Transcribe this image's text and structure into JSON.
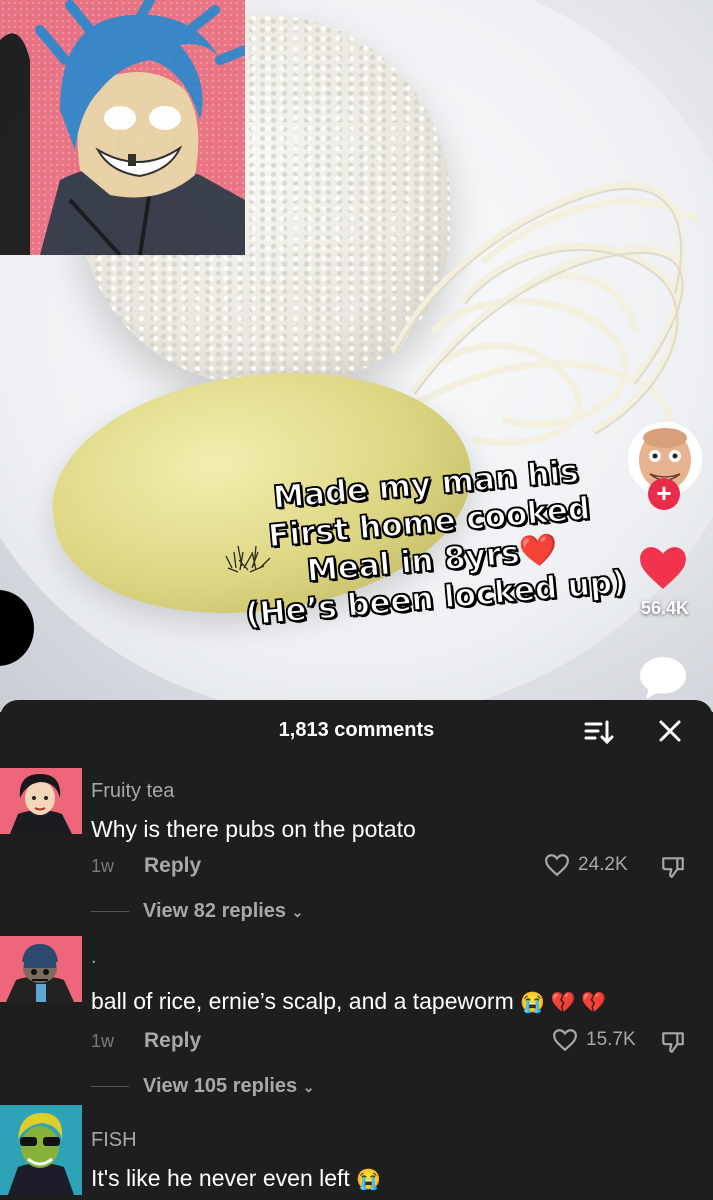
{
  "video": {
    "caption": [
      "Made my man his",
      "First home cooked",
      "Meal in 8yrs",
      "(He’s been locked up)"
    ],
    "caption_emoji": "❤️",
    "like_count": "56.4K",
    "follow_symbol": "+"
  },
  "comments_panel": {
    "count_label": "1,813 comments",
    "comments": [
      {
        "username": "Fruity tea",
        "text": "Why is there pubs on the potato",
        "time": "1w",
        "reply_label": "Reply",
        "likes": "24.2K",
        "view_replies": "View 82 replies"
      },
      {
        "username": ".",
        "text": "ball of rice, ernie’s scalp, and a tapeworm",
        "emojis": "😭 💔 💔",
        "time": "1w",
        "reply_label": "Reply",
        "likes": "15.7K",
        "view_replies": "View 105 replies"
      },
      {
        "username": "FISH",
        "text": "It's like he never even left",
        "emojis": "😭"
      }
    ]
  },
  "colors": {
    "accent_red": "#ea2c4b",
    "panel_bg": "#1e1e1e"
  }
}
